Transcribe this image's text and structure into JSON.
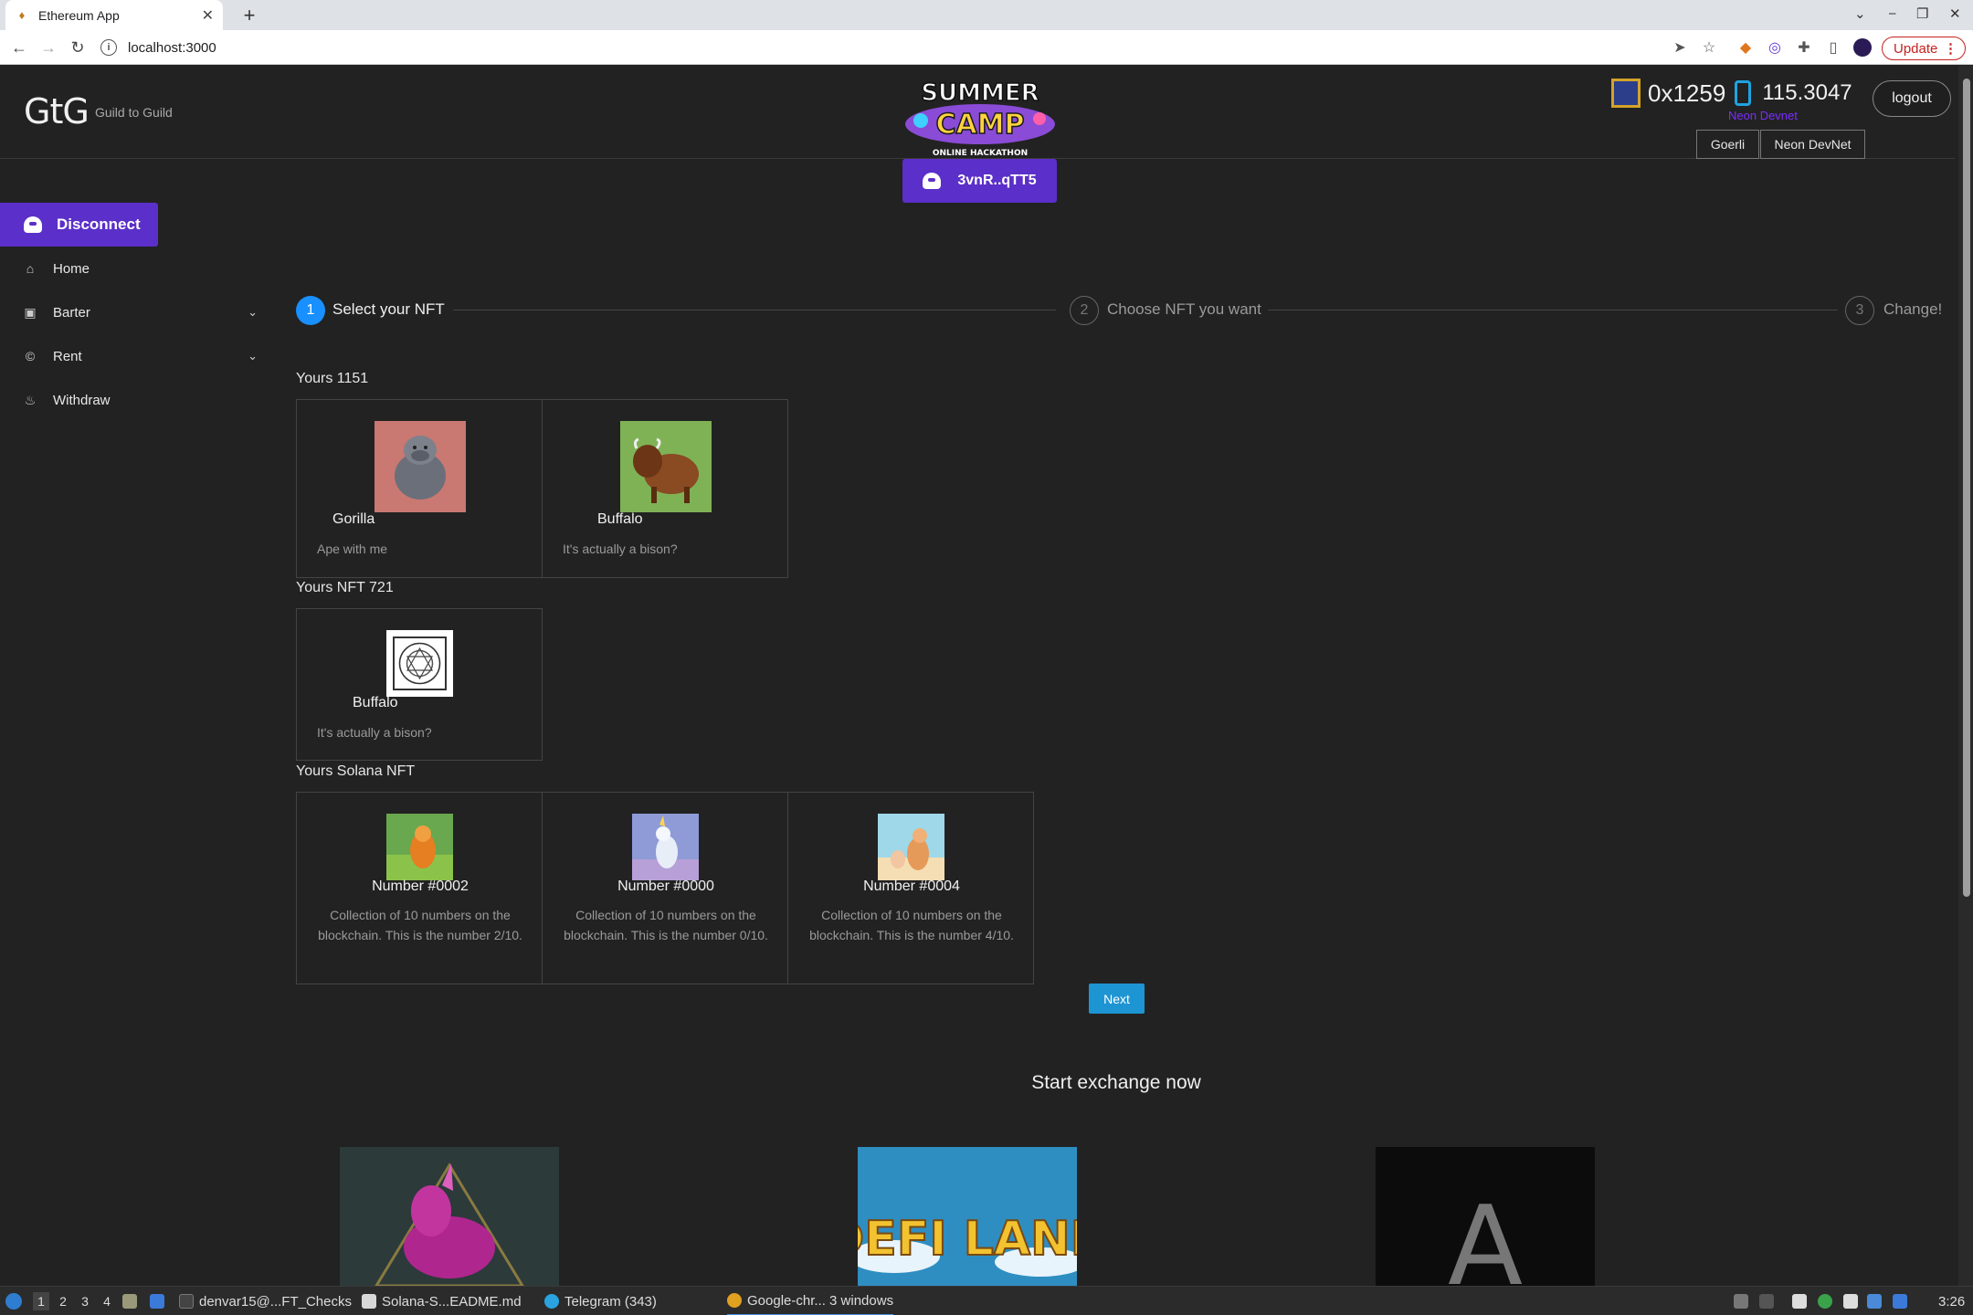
{
  "browser": {
    "tab_title": "Ethereum App",
    "tab_close": "✕",
    "new_tab": "+",
    "url": "localhost:3000",
    "update_label": "Update",
    "min": "⎯",
    "restore": "❐",
    "close": "✕",
    "chevron": "⌄"
  },
  "header": {
    "logo": "GtG",
    "logo_sub": "Guild to Guild",
    "address": "0x1259",
    "balance": "115.3047",
    "network_label": "Neon Devnet",
    "logout": "logout",
    "networks": [
      "Goerli",
      "Neon DevNet"
    ],
    "solana_wallet": "3vnR..qTT5",
    "hackathon_top": "SUMMER",
    "hackathon_mid": "CAMP",
    "hackathon_sub": "ONLINE HACKATHON"
  },
  "sidebar": {
    "disconnect": "Disconnect",
    "items": [
      {
        "label": "Home",
        "icon": "home-icon"
      },
      {
        "label": "Barter",
        "icon": "barter-icon"
      },
      {
        "label": "Rent",
        "icon": "rent-icon"
      },
      {
        "label": "Withdraw",
        "icon": "withdraw-icon"
      }
    ]
  },
  "stepper": {
    "steps": [
      {
        "num": "1",
        "label": "Select your NFT",
        "active": true
      },
      {
        "num": "2",
        "label": "Choose NFT you want",
        "active": false
      },
      {
        "num": "3",
        "label": "Change!",
        "active": false
      }
    ]
  },
  "sections": {
    "s1155": {
      "title": "Yours 1151",
      "cards": [
        {
          "name": "Gorilla",
          "desc": "Ape with me"
        },
        {
          "name": "Buffalo",
          "desc": "It's actually a bison?"
        }
      ]
    },
    "s721": {
      "title": "Yours NFT 721",
      "cards": [
        {
          "name": "Buffalo",
          "desc": "It's actually a bison?"
        }
      ]
    },
    "solana": {
      "title": "Yours Solana NFT",
      "cards": [
        {
          "name": "Number #0002",
          "desc": "Collection of 10 numbers on the blockchain. This is the number 2/10."
        },
        {
          "name": "Number #0000",
          "desc": "Collection of 10 numbers on the blockchain. This is the number 0/10."
        },
        {
          "name": "Number #0004",
          "desc": "Collection of 10 numbers on the blockchain. This is the number 4/10."
        }
      ]
    }
  },
  "next": "Next",
  "start_exchange": "Start exchange now",
  "promo": {
    "defi": "DEFI LAND",
    "letter": "A"
  },
  "taskbar": {
    "workspaces": [
      "1",
      "2",
      "3",
      "4"
    ],
    "terminal": "denvar15@...FT_Checks",
    "editor": "Solana-S...EADME.md",
    "telegram": "Telegram (343)",
    "chrome": "Google-chr... 3 windows",
    "clock": "3:26"
  }
}
